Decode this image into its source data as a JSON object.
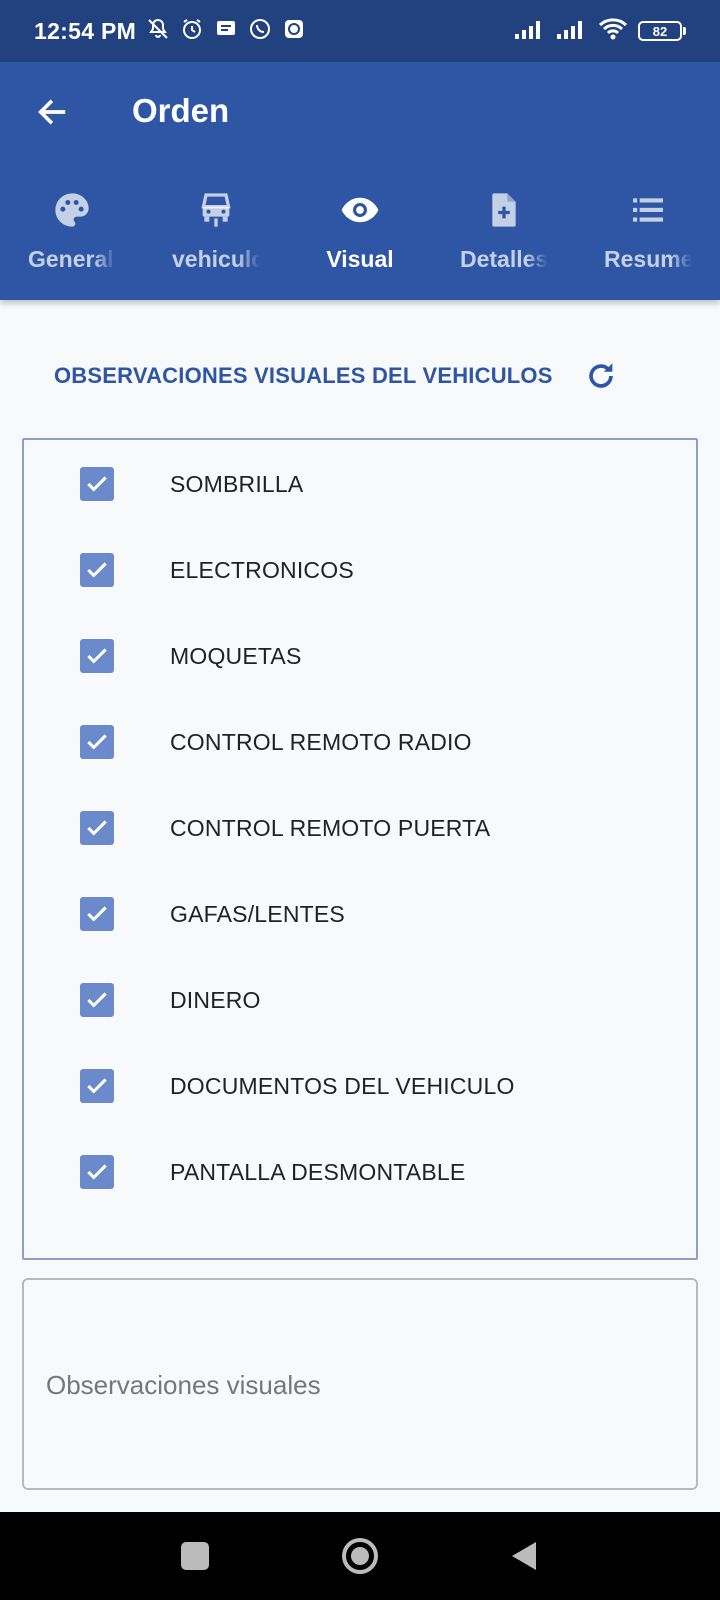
{
  "status_bar": {
    "time": "12:54 PM",
    "left_icons": [
      "mute-icon",
      "alarm-icon",
      "message-icon",
      "whatsapp-icon",
      "chat-icon"
    ],
    "battery": "82"
  },
  "app_bar": {
    "title": "Orden",
    "tabs": [
      {
        "label": "General",
        "icon": "palette-icon"
      },
      {
        "label": "vehiculo",
        "icon": "car-icon"
      },
      {
        "label": "Visual",
        "icon": "eye-icon",
        "active": true
      },
      {
        "label": "Detalles",
        "icon": "note-add-icon"
      },
      {
        "label": "Resumen",
        "icon": "list-icon"
      }
    ]
  },
  "section": {
    "title": "OBSERVACIONES VISUALES DEL VEHICULOS"
  },
  "checklist": [
    {
      "label": "SOMBRILLA",
      "checked": true
    },
    {
      "label": "ELECTRONICOS",
      "checked": true
    },
    {
      "label": "MOQUETAS",
      "checked": true
    },
    {
      "label": "CONTROL REMOTO RADIO",
      "checked": true
    },
    {
      "label": "CONTROL REMOTO PUERTA",
      "checked": true
    },
    {
      "label": "GAFAS/LENTES",
      "checked": true
    },
    {
      "label": "DINERO",
      "checked": true
    },
    {
      "label": "DOCUMENTOS DEL VEHICULO",
      "checked": true
    },
    {
      "label": "PANTALLA DESMONTABLE",
      "checked": true
    }
  ],
  "observations": {
    "placeholder": "Observaciones visuales",
    "value": ""
  },
  "colors": {
    "status_bar": "#22417f",
    "primary": "#2e56a5",
    "checkbox": "#6b8acb"
  }
}
